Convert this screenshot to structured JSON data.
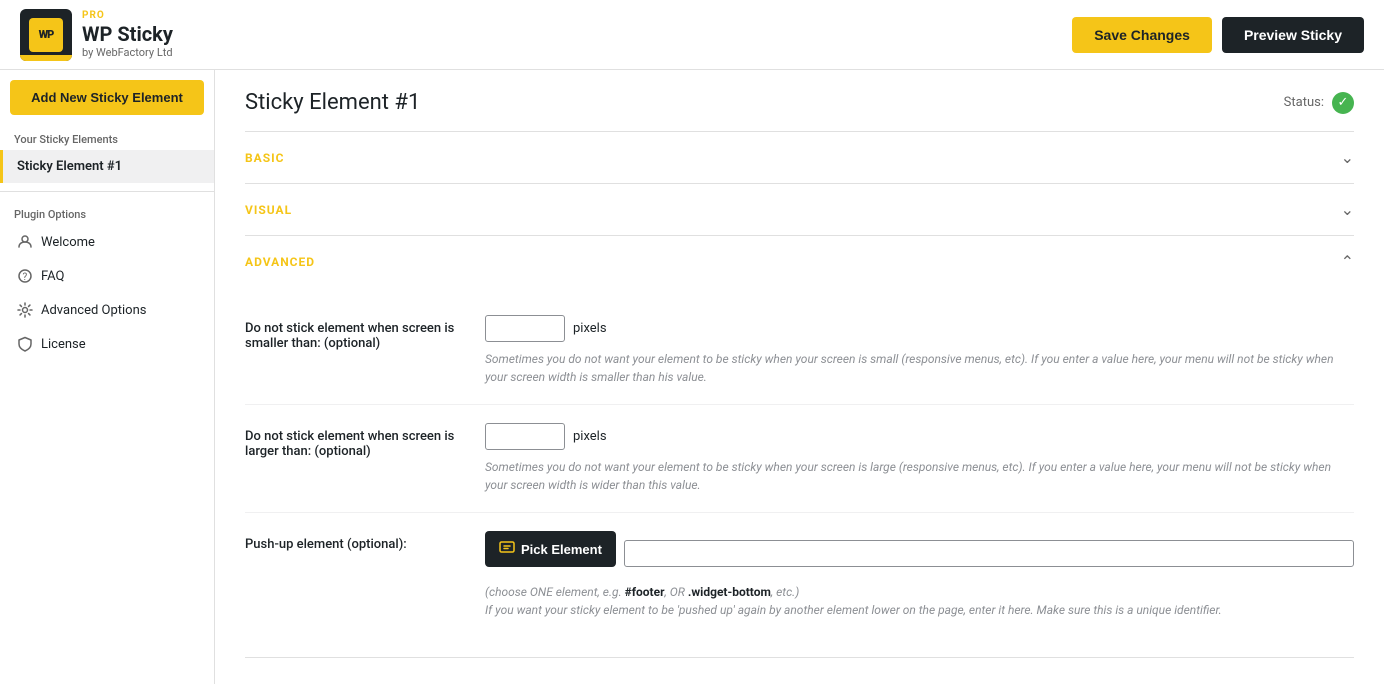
{
  "header": {
    "logo_alt": "WP Sticky",
    "logo_pro": "PRO",
    "logo_name": "WP Sticky",
    "logo_by": "by WebFactory Ltd",
    "save_label": "Save Changes",
    "preview_label": "Preview Sticky"
  },
  "sidebar": {
    "add_new_label": "Add New Sticky Element",
    "sticky_elements_label": "Your Sticky Elements",
    "sticky_element_item": "Sticky Element #1",
    "plugin_options_label": "Plugin Options",
    "menu_items": [
      {
        "label": "Welcome",
        "icon": "👋"
      },
      {
        "label": "FAQ",
        "icon": "❓"
      },
      {
        "label": "Advanced Options",
        "icon": "⚙"
      },
      {
        "label": "License",
        "icon": "🛡"
      }
    ]
  },
  "main": {
    "page_title": "Sticky Element #1",
    "status_label": "Status:",
    "sections": [
      {
        "id": "basic",
        "title": "BASIC",
        "collapsed": true
      },
      {
        "id": "visual",
        "title": "VISUAL",
        "collapsed": true
      },
      {
        "id": "advanced",
        "title": "ADVANCED",
        "collapsed": false
      }
    ],
    "advanced_fields": [
      {
        "id": "min-screen",
        "label": "Do not stick element when screen is smaller than: (optional)",
        "suffix": "pixels",
        "hint": "Sometimes you do not want your element to be sticky when your screen is small (responsive menus, etc). If you enter a value here, your menu will not be sticky when your screen width is smaller than his value."
      },
      {
        "id": "max-screen",
        "label": "Do not stick element when screen is larger than: (optional)",
        "suffix": "pixels",
        "hint": "Sometimes you do not want your element to be sticky when your screen is large (responsive menus, etc). If you enter a value here, your menu will not be sticky when your screen width is wider than this value."
      },
      {
        "id": "push-up",
        "label": "Push-up element (optional):",
        "btn_label": "Pick Element",
        "hint_line1": "(choose ONE element, e.g. #footer, OR .widget-bottom, etc.)",
        "hint_line2": "If you want your sticky element to be 'pushed up' again by another element lower on the page, enter it here. Make sure this is a unique identifier."
      }
    ]
  }
}
